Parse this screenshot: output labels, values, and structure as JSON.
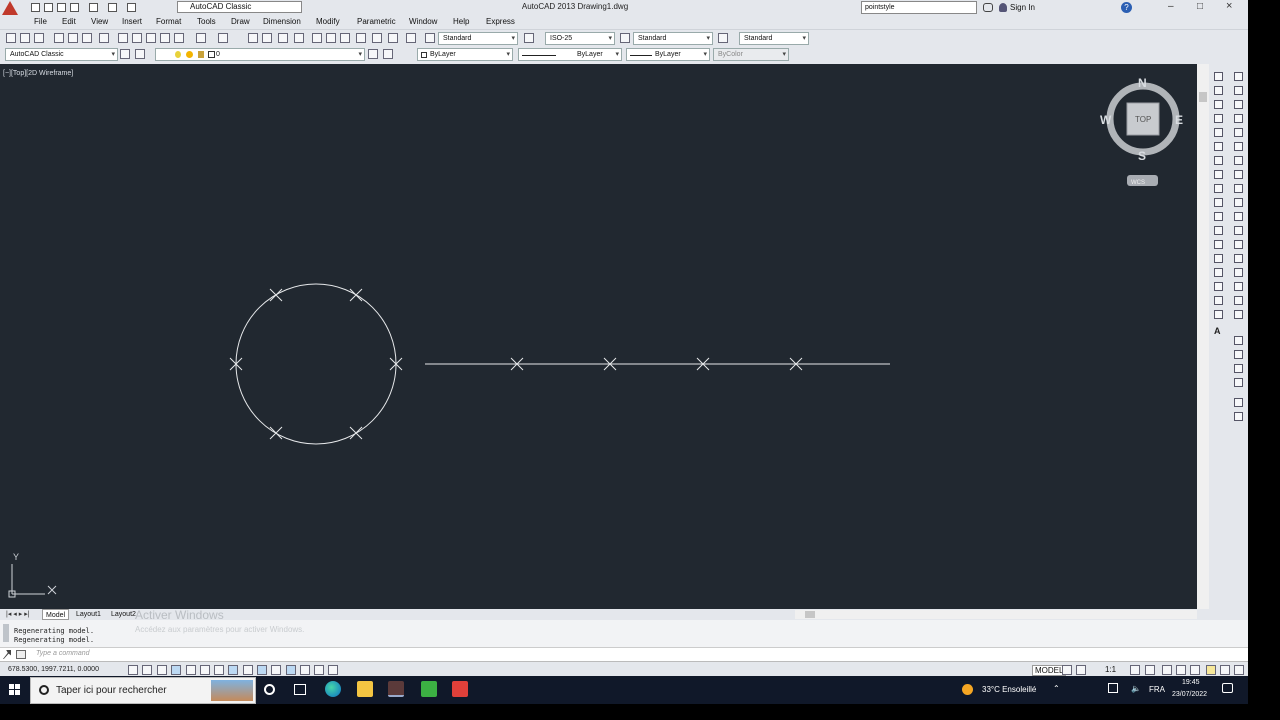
{
  "window": {
    "title": "AutoCAD 2013    Drawing1.dwg",
    "workspace": "AutoCAD Classic",
    "search_value": "pointstyle",
    "sign_in": "Sign In",
    "controls": [
      "–",
      "□",
      "×"
    ]
  },
  "menu": [
    "File",
    "Edit",
    "View",
    "Insert",
    "Format",
    "Tools",
    "Draw",
    "Dimension",
    "Modify",
    "Parametric",
    "Window",
    "Help",
    "Express"
  ],
  "toolbar1": {
    "text_style": "Standard",
    "dim_style": "ISO-25",
    "table_style": "Standard",
    "mleader_style": "Standard"
  },
  "toolbar2": {
    "workspace": "AutoCAD Classic",
    "layer": "0",
    "color": "ByLayer",
    "linetype": "ByLayer",
    "lineweight": "ByLayer",
    "plotstyle": "ByColor"
  },
  "viewport": {
    "label": "[−][Top][2D Wireframe]",
    "viewcube": {
      "n": "N",
      "s": "S",
      "e": "E",
      "w": "W",
      "top": "TOP",
      "wcs": "WCS"
    },
    "ucs": {
      "x": "X",
      "y": "Y"
    }
  },
  "tabs": [
    "Model",
    "Layout1",
    "Layout2"
  ],
  "watermark": {
    "line1": "Activer Windows",
    "line2": "Accédez aux paramètres pour activer Windows."
  },
  "command": {
    "history": [
      "Regenerating model.",
      "Regenerating model."
    ],
    "placeholder": "Type a command"
  },
  "status": {
    "coords": "678.5300, 1997.7211, 0.0000",
    "model": "MODEL",
    "scale": "1:1"
  },
  "taskbar": {
    "search_placeholder": "Taper ici pour rechercher",
    "weather": "33°C  Ensoleillé",
    "lang": "FRA",
    "time": "19:45",
    "date": "23/07/2022"
  },
  "colors": {
    "viewport_bg": "#212830",
    "ui_bg": "#e4e7ec",
    "taskbar_bg": "#101829",
    "autocad_red": "#c0392b"
  }
}
